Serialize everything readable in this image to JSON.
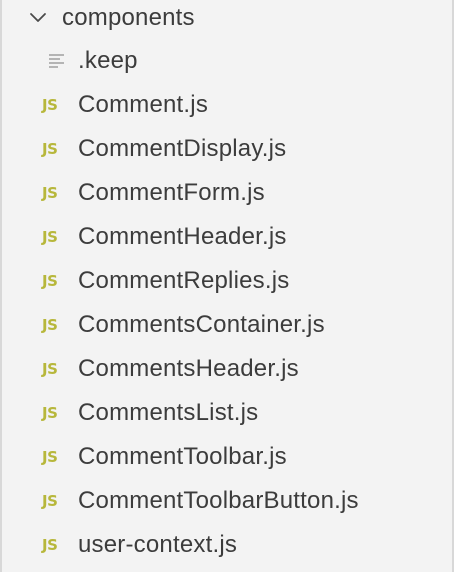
{
  "explorer": {
    "folder": {
      "name": "components",
      "expanded": true,
      "chevron_icon": "chevron-down-icon"
    },
    "files": [
      {
        "name": ".keep",
        "icon": "text-file-icon"
      },
      {
        "name": "Comment.js",
        "icon": "js-file-icon",
        "icon_text": "JS"
      },
      {
        "name": "CommentDisplay.js",
        "icon": "js-file-icon",
        "icon_text": "JS"
      },
      {
        "name": "CommentForm.js",
        "icon": "js-file-icon",
        "icon_text": "JS"
      },
      {
        "name": "CommentHeader.js",
        "icon": "js-file-icon",
        "icon_text": "JS"
      },
      {
        "name": "CommentReplies.js",
        "icon": "js-file-icon",
        "icon_text": "JS"
      },
      {
        "name": "CommentsContainer.js",
        "icon": "js-file-icon",
        "icon_text": "JS"
      },
      {
        "name": "CommentsHeader.js",
        "icon": "js-file-icon",
        "icon_text": "JS"
      },
      {
        "name": "CommentsList.js",
        "icon": "js-file-icon",
        "icon_text": "JS"
      },
      {
        "name": "CommentToolbar.js",
        "icon": "js-file-icon",
        "icon_text": "JS"
      },
      {
        "name": "CommentToolbarButton.js",
        "icon": "js-file-icon",
        "icon_text": "JS"
      },
      {
        "name": "user-context.js",
        "icon": "js-file-icon",
        "icon_text": "JS"
      }
    ]
  },
  "colors": {
    "background": "#f3f3f3",
    "text": "#3c3c3c",
    "js_icon": "#b7b73b",
    "border": "#d8d8d8"
  }
}
